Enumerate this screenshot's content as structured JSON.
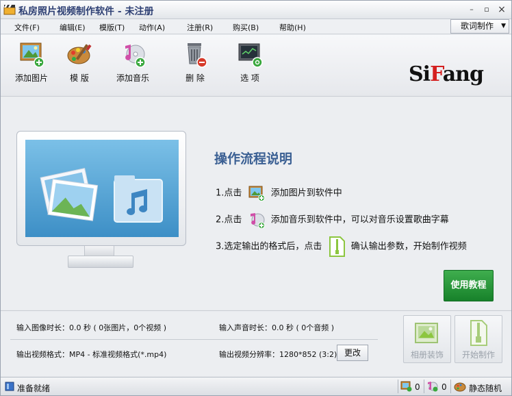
{
  "window": {
    "title": "私房照片视频制作软件 - 未注册",
    "minimize": "–",
    "maximize": "▫",
    "close": "×"
  },
  "menu": [
    {
      "label": "文件(F)"
    },
    {
      "label": "编辑(E)"
    },
    {
      "label": "模版(T)"
    },
    {
      "label": "动作(A)"
    },
    {
      "label": "注册(R)"
    },
    {
      "label": "购买(B)"
    },
    {
      "label": "帮助(H)"
    }
  ],
  "lyric_button": {
    "label": "歌词制作"
  },
  "toolbar": {
    "add_image": "添加图片",
    "template": "模 版",
    "add_music": "添加音乐",
    "delete": "删 除",
    "options": "选 项"
  },
  "logo": {
    "pre": "Si",
    "accent": "F",
    "post": "ang"
  },
  "guide": {
    "title": "操作流程说明",
    "step1_prefix": "1.点击",
    "step1_text": "添加图片到软件中",
    "step2_prefix": "2.点击",
    "step2_text": "添加音乐到软件中，可以对音乐设置歌曲字幕",
    "step3_prefix": "3.选定输出的格式后，点击",
    "step3_text": "确认输出参数，开始制作视频",
    "tutorial_button": "使用教程"
  },
  "info": {
    "image_duration": "输入图像时长：0.0 秒 ( 0张图片，0个视频 )",
    "audio_duration": "输入声音时长：0.0 秒 ( 0个音频 )",
    "output_format": "输出视频格式：MP4 - 标准视频格式(*.mp4)",
    "output_resolution": "输出视频分辨率：1280*852 (3:2)",
    "change_button": "更改",
    "album_button": "相册装饰",
    "start_button": "开始制作"
  },
  "status": {
    "ready": "准备就绪",
    "image_count": "0",
    "music_count": "0",
    "mode": "静态随机"
  },
  "colors": {
    "accent_title": "#3a5f93",
    "tutorial_green": "#1f8f33",
    "logo_red": "#d42020"
  }
}
